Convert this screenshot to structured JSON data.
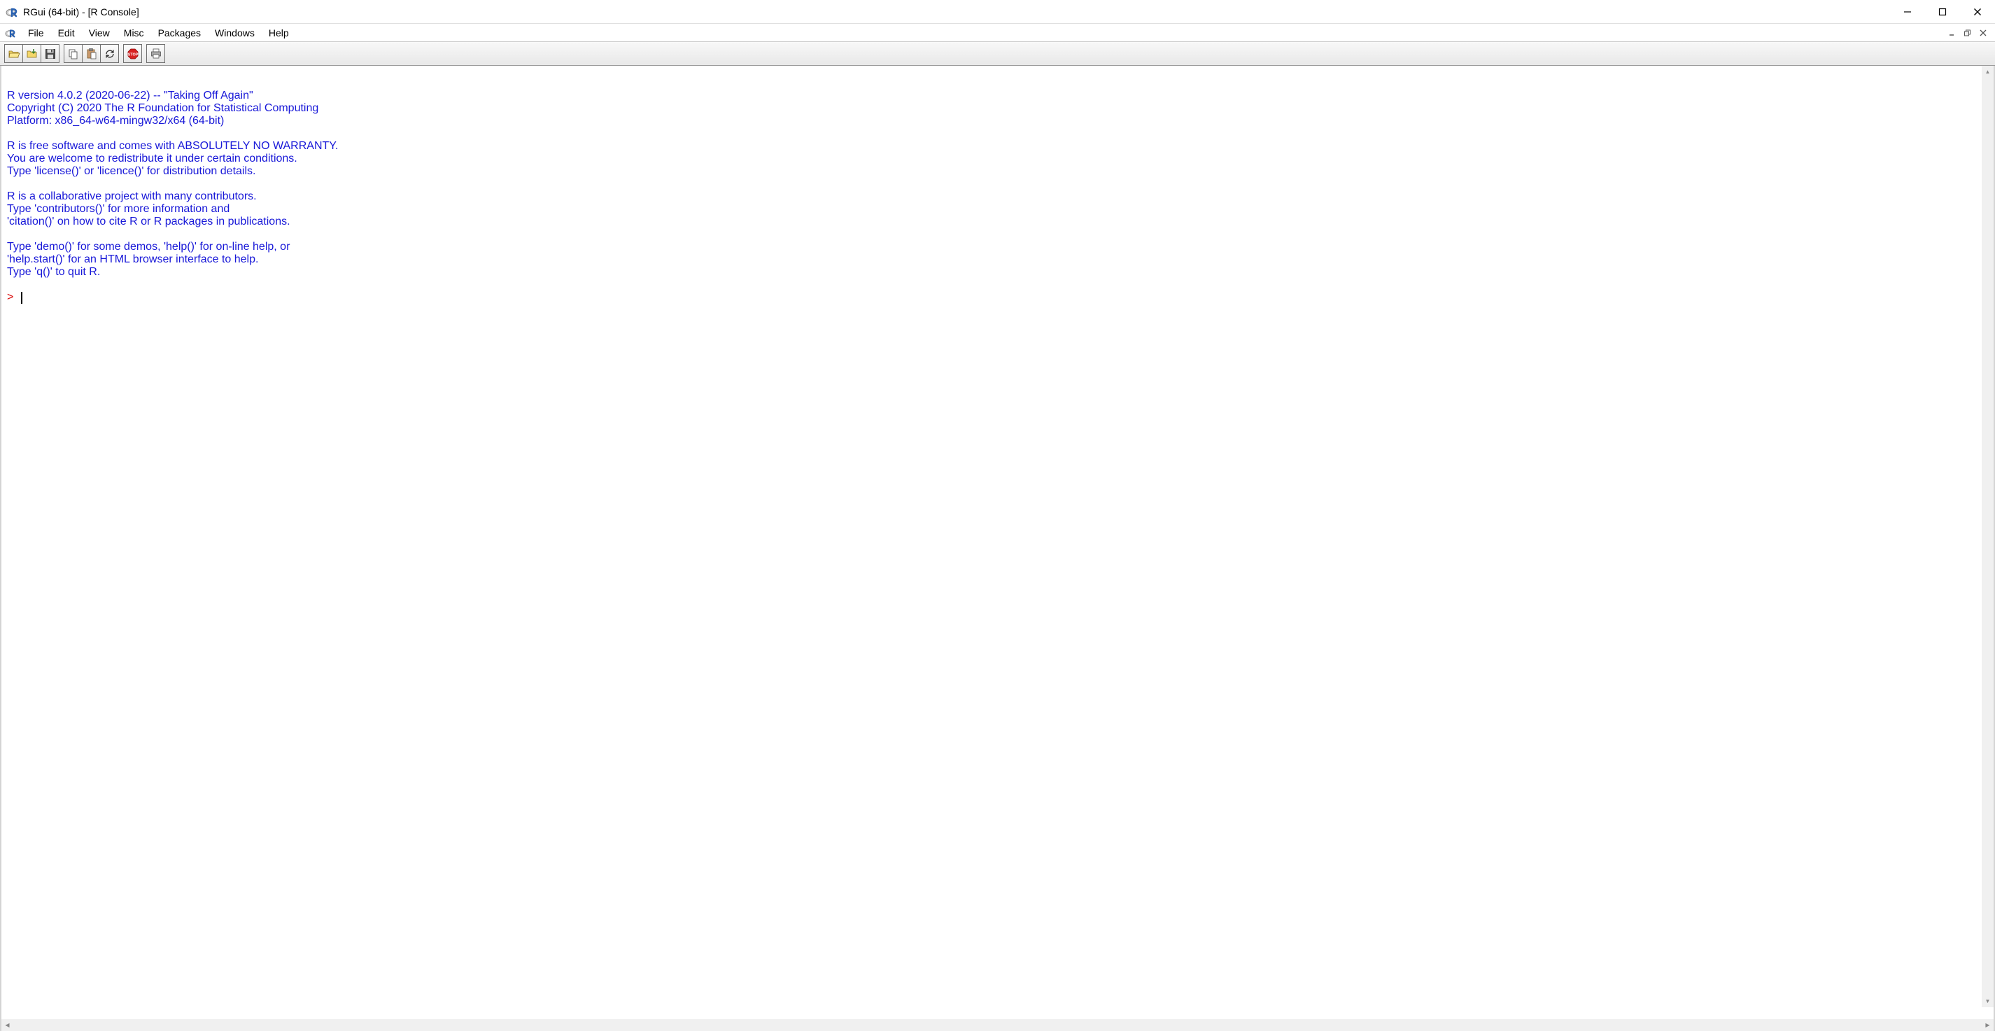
{
  "window": {
    "title": "RGui (64-bit) - [R Console]"
  },
  "menu": {
    "items": [
      "File",
      "Edit",
      "View",
      "Misc",
      "Packages",
      "Windows",
      "Help"
    ]
  },
  "toolbar": {
    "buttons": [
      "open-script",
      "load-workspace",
      "save-workspace",
      "copy",
      "paste",
      "copy-paste",
      "stop",
      "print"
    ]
  },
  "console": {
    "lines": [
      "",
      "R version 4.0.2 (2020-06-22) -- \"Taking Off Again\"",
      "Copyright (C) 2020 The R Foundation for Statistical Computing",
      "Platform: x86_64-w64-mingw32/x64 (64-bit)",
      "",
      "R is free software and comes with ABSOLUTELY NO WARRANTY.",
      "You are welcome to redistribute it under certain conditions.",
      "Type 'license()' or 'licence()' for distribution details.",
      "",
      "R is a collaborative project with many contributors.",
      "Type 'contributors()' for more information and",
      "'citation()' on how to cite R or R packages in publications.",
      "",
      "Type 'demo()' for some demos, 'help()' for on-line help, or",
      "'help.start()' for an HTML browser interface to help.",
      "Type 'q()' to quit R.",
      ""
    ],
    "prompt": "> "
  }
}
